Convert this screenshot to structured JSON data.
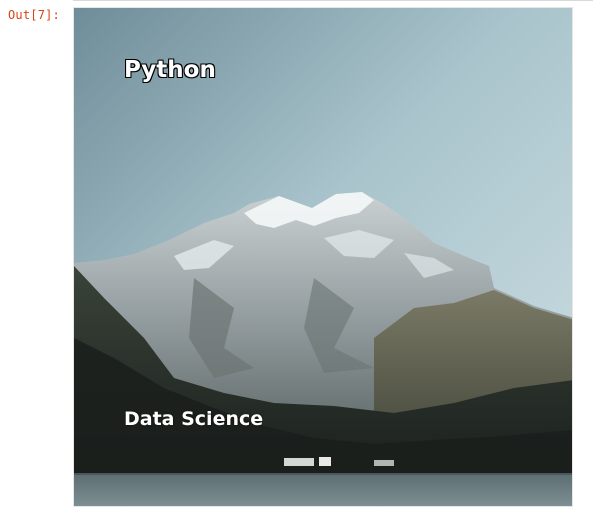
{
  "cell": {
    "prompt_label": "Out[7]:"
  },
  "image": {
    "title": "Python",
    "subtitle": "Data Science"
  }
}
